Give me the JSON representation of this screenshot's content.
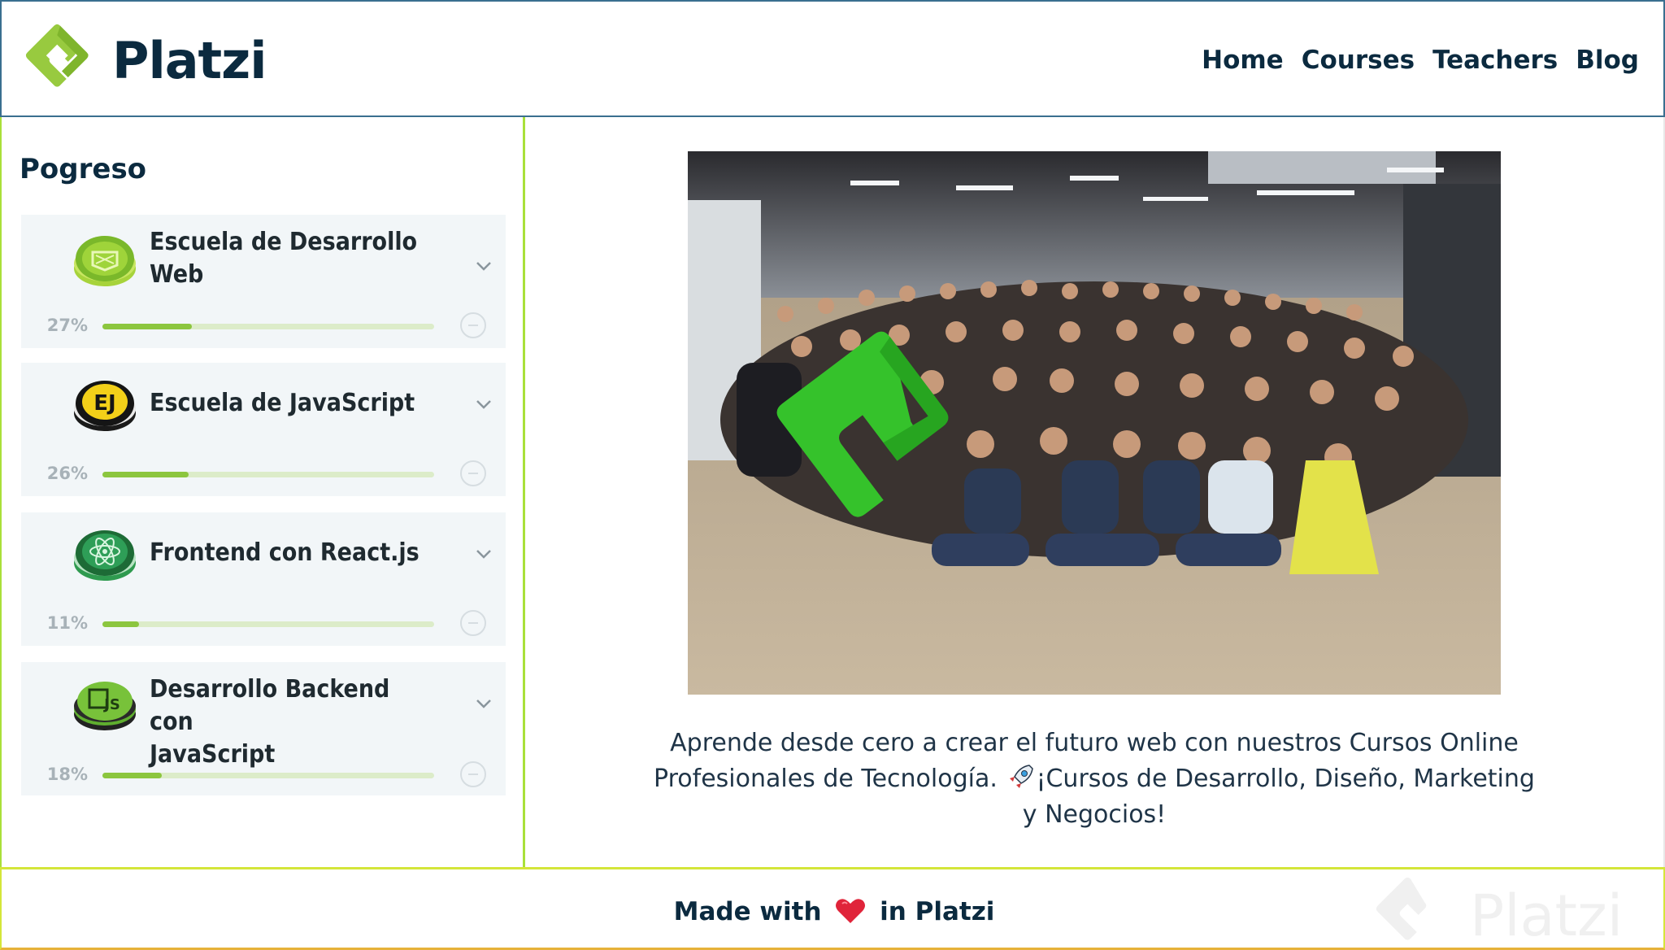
{
  "header": {
    "brand": "Platzi",
    "nav": [
      "Home",
      "Courses",
      "Teachers",
      "Blog"
    ]
  },
  "colors": {
    "brand_green": "#98ca3f",
    "dark_navy": "#0b2a3f",
    "progress_fill": "#8cc63f",
    "sidebar_border": "#a9e03a"
  },
  "sidebar": {
    "title": "Pogreso",
    "schools": [
      {
        "name_line1": "Escuela de Desarrollo",
        "name_line2": "Web",
        "percent": "27%",
        "progress": 0.27,
        "icon": "web-development-badge-icon"
      },
      {
        "name_line1": "Escuela de JavaScript",
        "name_line2": "",
        "percent": "26%",
        "progress": 0.26,
        "icon": "javascript-badge-icon"
      },
      {
        "name_line1": "Frontend con React.js",
        "name_line2": "",
        "percent": "11%",
        "progress": 0.11,
        "icon": "react-badge-icon"
      },
      {
        "name_line1": "Desarrollo Backend con",
        "name_line2": "JavaScript",
        "percent": "18%",
        "progress": 0.18,
        "icon": "backend-js-badge-icon"
      }
    ]
  },
  "main": {
    "caption_part1": "Aprende desde cero a crear el futuro web con nuestros Cursos Online Profesionales de Tecnología.",
    "caption_part2": "¡Cursos de Desarrollo, Diseño, Marketing y Negocios!",
    "caption_emoji": "rocket-icon",
    "hero_image": "platzi-team-group-photo"
  },
  "footer": {
    "text_before": "Made with",
    "text_after": "in Platzi",
    "heart_icon": "heart-icon",
    "watermark": "Platzi"
  }
}
